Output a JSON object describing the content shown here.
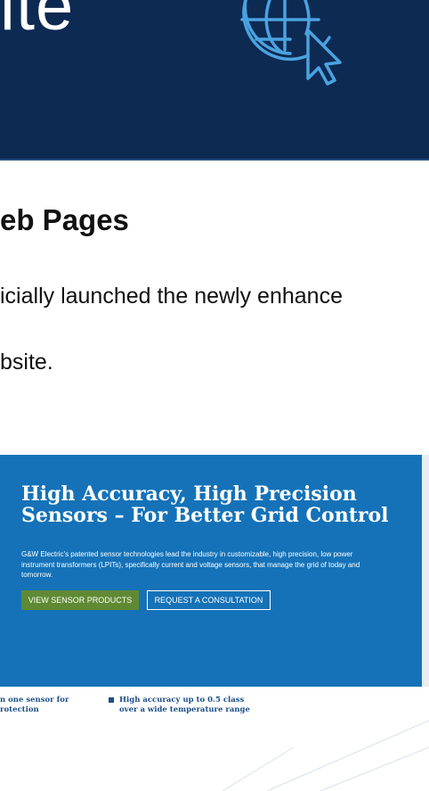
{
  "banner": {
    "title_fragment": "ite",
    "icon": "globe-cursor-icon",
    "background": "#0d2a52"
  },
  "article": {
    "heading": "eb Pages",
    "line1": "icially launched the newly enhance",
    "line2": "bsite."
  },
  "site_preview": {
    "hero_title": "High Accuracy, High Precision Sensors – For Better Grid Control",
    "hero_description": "G&W Electric's patented sensor technologies lead the industry in customizable, high precision, low power instrument transformers (LPITs), specifically current and voltage sensors, that manage the grid of today and tomorrow.",
    "primary_button": "VIEW SENSOR PRODUCTS",
    "secondary_button": "REQUEST A CONSULTATION",
    "features": [
      {
        "line1": "n one sensor for",
        "line2": "rotection"
      },
      {
        "line1": "High accuracy up to 0.5 class",
        "line2": "over a wide temperature range"
      }
    ],
    "colors": {
      "hero": "#1572b8",
      "primary_button": "#5f8a33",
      "feature_text": "#1b4f86"
    }
  }
}
